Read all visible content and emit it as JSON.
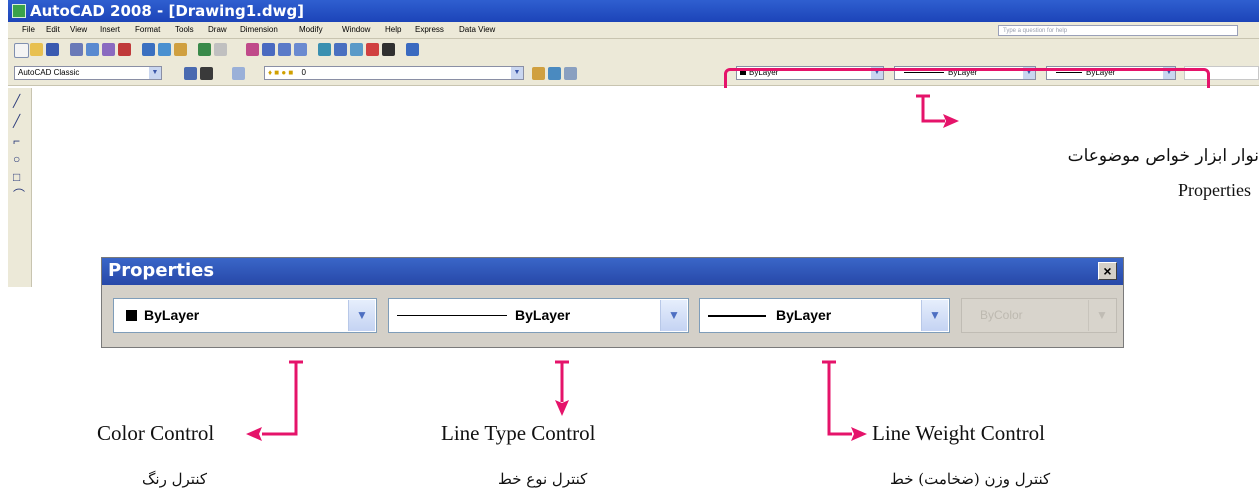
{
  "window": {
    "title": "AutoCAD 2008 - [Drawing1.dwg]"
  },
  "menu": [
    "File",
    "Edit",
    "View",
    "Insert",
    "Format",
    "Tools",
    "Draw",
    "Dimension",
    "Modify",
    "Window",
    "Help",
    "Express",
    "Data View"
  ],
  "help_search": {
    "placeholder": "Type a question for help"
  },
  "workspace": {
    "value": "AutoCAD Classic"
  },
  "layer": {
    "value": "0"
  },
  "toolbar_small": {
    "color": "ByLayer",
    "linetype": "ByLayer",
    "lineweight": "ByLayer"
  },
  "annotation": {
    "persian": "نوار ابزار خواص موضوعات",
    "english": "Properties"
  },
  "properties_toolbar": {
    "title": "Properties",
    "close_label": "×",
    "color_value": "ByLayer",
    "linetype_value": "ByLayer",
    "lineweight_value": "ByLayer",
    "plotstyle_value": "ByColor"
  },
  "labels": {
    "color": {
      "en": "Color Control",
      "fa": "كنترل رنگ"
    },
    "linetype": {
      "en": "Line Type Control",
      "fa": "كنترل نوع خط"
    },
    "lineweight": {
      "en": "Line Weight Control",
      "fa": "كنترل وزن (ضخامت) خط"
    }
  },
  "colors": {
    "accent": "#e5136a",
    "title_bar": "#2748a8",
    "toolbar": "#ece9d8"
  },
  "icons": [
    "app-icon",
    "close-icon",
    "dropdown-arrow-icon",
    "line-tool-icon",
    "circle-tool-icon",
    "rectangle-tool-icon",
    "arc-tool-icon"
  ]
}
